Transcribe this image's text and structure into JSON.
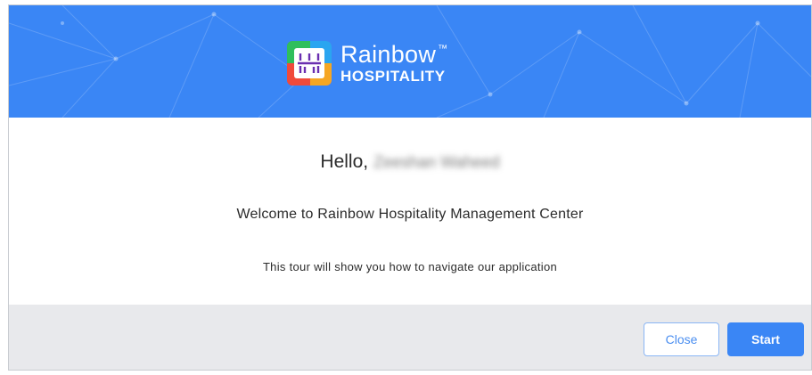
{
  "header": {
    "brand_name": "Rainbow",
    "brand_trademark": "™",
    "brand_subtitle": "HOSPITALITY",
    "background_color": "#3a86f5"
  },
  "body": {
    "greeting": "Hello,",
    "user_name": "Zeeshan Waheed",
    "welcome": "Welcome to Rainbow Hospitality Management Center",
    "tour_text": "This tour will show you how to navigate our application"
  },
  "footer": {
    "close_label": "Close",
    "start_label": "Start",
    "accent_color": "#3a86f5"
  },
  "icons": {
    "logo": "rainbow-logo-icon"
  }
}
